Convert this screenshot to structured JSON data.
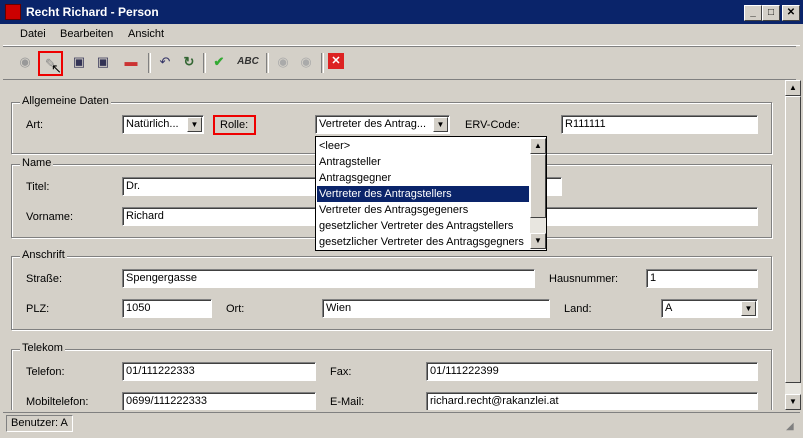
{
  "window": {
    "title": "Recht Richard - Person",
    "minimize": "_",
    "maximize": "□",
    "close": "✕"
  },
  "menu": [
    "Datei",
    "Bearbeiten",
    "Ansicht"
  ],
  "toolbar": {
    "icons": [
      "back-icon",
      "edit-icon",
      "save-icon",
      "save-close-icon",
      "delete-icon",
      "undo-icon",
      "redo-icon",
      "check-icon",
      "spellcheck-icon",
      "up-icon",
      "down-icon",
      "cancel-icon"
    ],
    "spell_label": "ABC"
  },
  "allgemein": {
    "title": "Allgemeine Daten",
    "art_label": "Art:",
    "art_value": "Natürlich...",
    "rolle_label": "Rolle:",
    "rolle_value": "Vertreter des Antrag...",
    "erv_label": "ERV-Code:",
    "erv_value": "R111111",
    "dropdown_options": [
      "<leer>",
      "Antragsteller",
      "Antragsgegner",
      "Vertreter des Antragstellers",
      "Vertreter des Antragsgegeners",
      "gesetzlicher Vertreter des Antragstellers",
      "gesetzlicher Vertreter des Antragsgegners"
    ],
    "selected_option_index": 3
  },
  "name": {
    "title": "Name",
    "titel_label": "Titel:",
    "titel_value": "Dr.",
    "vorname_label": "Vorname:",
    "vorname_value": "Richard"
  },
  "anschrift": {
    "title": "Anschrift",
    "strasse_label": "Straße:",
    "strasse_value": "Spengergasse",
    "hausnummer_label": "Hausnummer:",
    "hausnummer_value": "1",
    "plz_label": "PLZ:",
    "plz_value": "1050",
    "ort_label": "Ort:",
    "ort_value": "Wien",
    "land_label": "Land:",
    "land_value": "A"
  },
  "telekom": {
    "title": "Telekom",
    "telefon_label": "Telefon:",
    "telefon_value": "01/111222333",
    "fax_label": "Fax:",
    "fax_value": "01/111222399",
    "mobil_label": "Mobiltelefon:",
    "mobil_value": "0699/111222333",
    "email_label": "E-Mail:",
    "email_value": "richard.recht@rakanzlei.at"
  },
  "status": {
    "user": "Benutzer: A"
  }
}
